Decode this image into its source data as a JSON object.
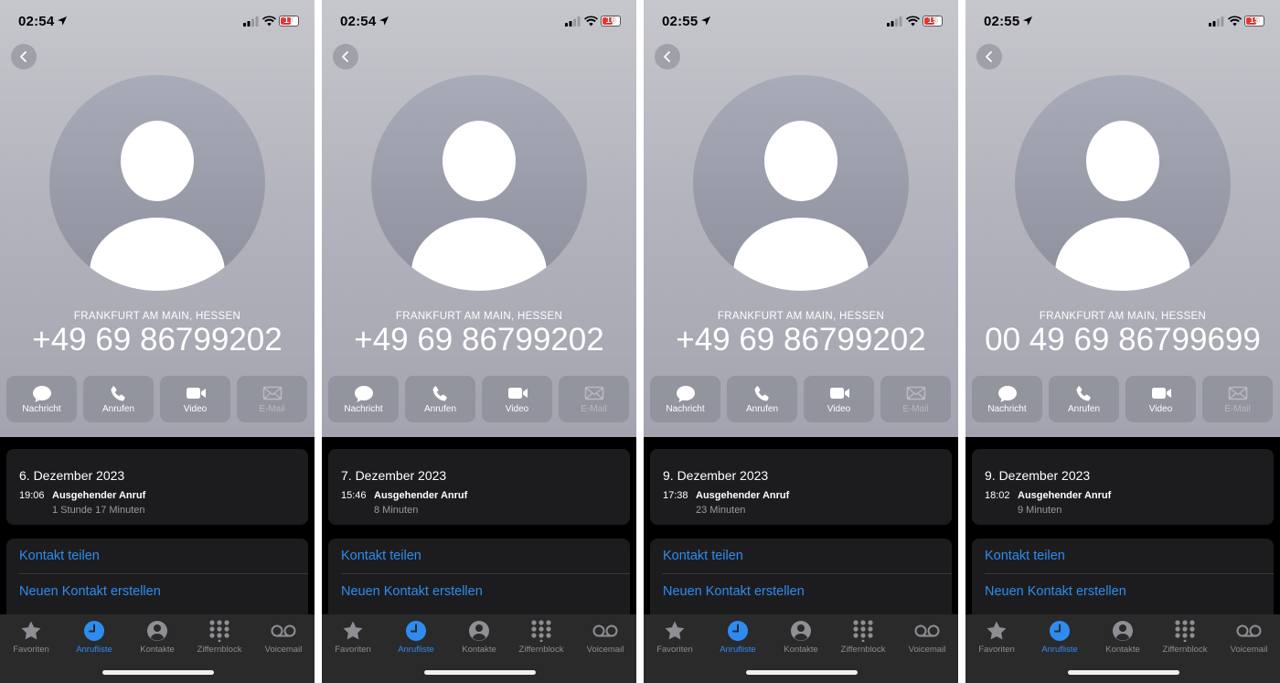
{
  "screens": [
    {
      "status": {
        "time": "02:54",
        "battery": "17"
      },
      "location": "FRANKFURT AM MAIN, HESSEN",
      "number": "+49 69 86799202",
      "actions": [
        "Nachricht",
        "Anrufen",
        "Video",
        "E-Mail"
      ],
      "call": {
        "date": "6. Dezember 2023",
        "time": "19:06",
        "type": "Ausgehender Anruf",
        "duration": "1 Stunde 17 Minuten"
      },
      "menu": [
        "Kontakt teilen",
        "Neuen Kontakt erstellen"
      ],
      "tabs": [
        "Favoriten",
        "Anrufliste",
        "Kontakte",
        "Ziffernblock",
        "Voicemail"
      ]
    },
    {
      "status": {
        "time": "02:54",
        "battery": "16"
      },
      "location": "FRANKFURT AM MAIN, HESSEN",
      "number": "+49 69 86799202",
      "actions": [
        "Nachricht",
        "Anrufen",
        "Video",
        "E-Mail"
      ],
      "call": {
        "date": "7. Dezember 2023",
        "time": "15:46",
        "type": "Ausgehender Anruf",
        "duration": "8 Minuten"
      },
      "menu": [
        "Kontakt teilen",
        "Neuen Kontakt erstellen"
      ],
      "tabs": [
        "Favoriten",
        "Anrufliste",
        "Kontakte",
        "Ziffernblock",
        "Voicemail"
      ]
    },
    {
      "status": {
        "time": "02:55",
        "battery": "15"
      },
      "location": "FRANKFURT AM MAIN, HESSEN",
      "number": "+49 69 86799202",
      "actions": [
        "Nachricht",
        "Anrufen",
        "Video",
        "E-Mail"
      ],
      "call": {
        "date": "9. Dezember 2023",
        "time": "17:38",
        "type": "Ausgehender Anruf",
        "duration": "23 Minuten"
      },
      "menu": [
        "Kontakt teilen",
        "Neuen Kontakt erstellen"
      ],
      "tabs": [
        "Favoriten",
        "Anrufliste",
        "Kontakte",
        "Ziffernblock",
        "Voicemail"
      ]
    },
    {
      "status": {
        "time": "02:55",
        "battery": "15"
      },
      "location": "FRANKFURT AM MAIN, HESSEN",
      "number": "00 49 69 86799699",
      "actions": [
        "Nachricht",
        "Anrufen",
        "Video",
        "E-Mail"
      ],
      "call": {
        "date": "9. Dezember 2023",
        "time": "18:02",
        "type": "Ausgehender Anruf",
        "duration": "9 Minuten"
      },
      "menu": [
        "Kontakt teilen",
        "Neuen Kontakt erstellen"
      ],
      "tabs": [
        "Favoriten",
        "Anrufliste",
        "Kontakte",
        "Ziffernblock",
        "Voicemail"
      ]
    }
  ],
  "colors": {
    "accent": "#2e8cf0",
    "card": "#1c1c1e",
    "tabbar": "#2a2a2b",
    "battery_low": "#e33333"
  },
  "icons": {
    "actions": [
      "message-icon",
      "phone-icon",
      "video-icon",
      "mail-icon"
    ],
    "tabs": [
      "star-icon",
      "clock-icon",
      "person-circle-icon",
      "keypad-icon",
      "voicemail-icon"
    ]
  }
}
